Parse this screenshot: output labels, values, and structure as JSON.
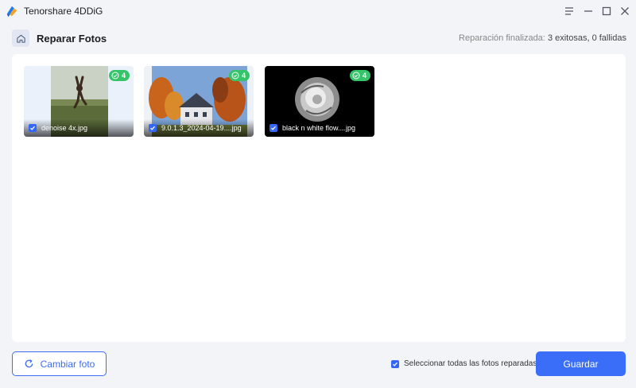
{
  "app": {
    "title": "Tenorshare 4DDiG"
  },
  "colors": {
    "accent": "#3b6ef8",
    "success": "#35c46a"
  },
  "header": {
    "title": "Reparar Fotos",
    "status_label": "Reparación finalizada:",
    "status_value": "3 exitosas, 0 fallidas"
  },
  "photos": [
    {
      "name": "denoise 4x.jpg",
      "badge": "4",
      "checked": true
    },
    {
      "name": "9.0.1.3_2024-04-19....jpg",
      "badge": "4",
      "checked": true
    },
    {
      "name": "black n white flow....jpg",
      "badge": "4",
      "checked": true
    }
  ],
  "footer": {
    "change_label": "Cambiar foto",
    "select_all_label": "Seleccionar todas las fotos reparadas",
    "select_all_checked": true,
    "save_label": "Guardar"
  },
  "icons": {
    "logo": "app-logo-icon",
    "menu": "menu-icon",
    "minimize": "minimize-icon",
    "maximize": "maximize-icon",
    "close": "close-icon",
    "home": "home-icon",
    "refresh": "refresh-icon"
  }
}
